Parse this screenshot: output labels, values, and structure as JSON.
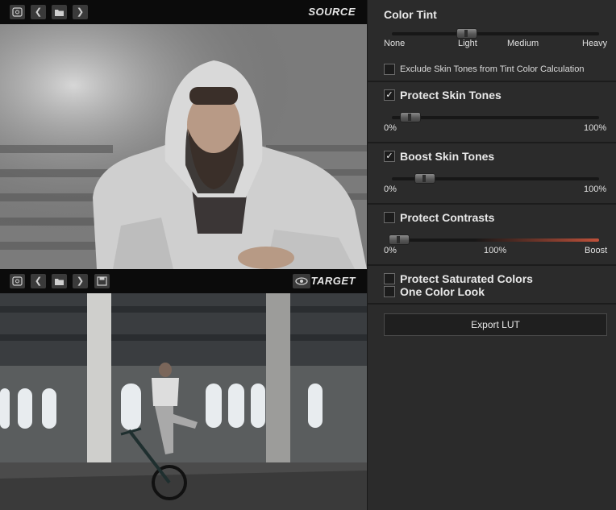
{
  "source_panel": {
    "label": "SOURCE"
  },
  "target_panel": {
    "label": "TARGET"
  },
  "color_tint": {
    "title": "Color Tint",
    "scale_labels": [
      "None",
      "Light",
      "Medium",
      "Heavy"
    ],
    "exclude_label": "Exclude Skin Tones from Tint Color Calculation",
    "exclude_checked": false
  },
  "protect_skin": {
    "label": "Protect Skin Tones",
    "checked": true,
    "min": "0%",
    "max": "100%"
  },
  "boost_skin": {
    "label": "Boost Skin Tones",
    "checked": true,
    "min": "0%",
    "max": "100%"
  },
  "protect_contrasts": {
    "label": "Protect Contrasts",
    "checked": false,
    "min": "0%",
    "mid": "100%",
    "max": "Boost"
  },
  "protect_saturated": {
    "label": "Protect Saturated Colors",
    "checked": false
  },
  "one_color": {
    "label": "One Color Look",
    "checked": false
  },
  "export": {
    "label": "Export LUT"
  },
  "colors": {
    "panel": "#2b2b2b",
    "accent": "#c0513a"
  }
}
